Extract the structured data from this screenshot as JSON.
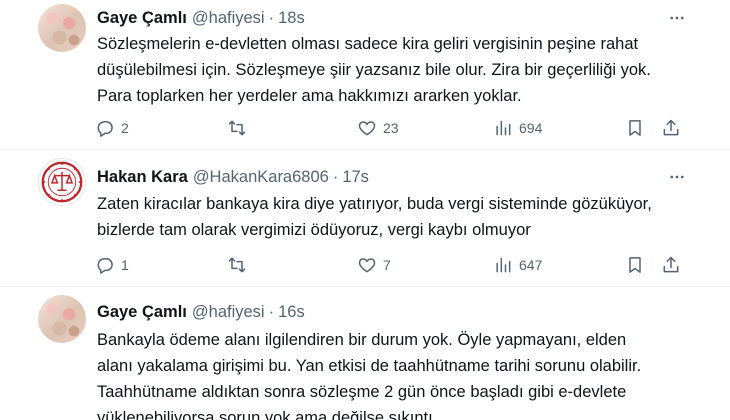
{
  "tweets": [
    {
      "name": "Gaye Çamlı",
      "handle": "@hafiyesi",
      "dot": "·",
      "time": "18s",
      "lines": [
        "Sözleşmelerin e-devletten olması sadece kira geliri vergisinin peşine rahat",
        "düşülebilmesi için. Sözleşmeye şiir yazsanız bile olur. Zira bir geçerliliği yok.",
        "Para toplarken her yerdeler ama hakkımızı ararken yoklar."
      ],
      "replies": "2",
      "retweets": "",
      "likes": "23",
      "views": "694"
    },
    {
      "name": "Hakan Kara",
      "handle": "@HakanKara6806",
      "dot": "·",
      "time": "17s",
      "lines": [
        "Zaten kiracılar bankaya kira diye yatırıyor, buda vergi sisteminde gözüküyor,",
        "bizlerde tam olarak vergimizi ödüyoruz, vergi kaybı olmuyor"
      ],
      "replies": "1",
      "retweets": "",
      "likes": "7",
      "views": "647"
    },
    {
      "name": "Gaye Çamlı",
      "handle": "@hafiyesi",
      "dot": "·",
      "time": "16s",
      "lines": [
        "Bankayla ödeme alanı ilgilendiren bir durum yok. Öyle yapmayanı, elden",
        "alanı yakalama girişimi bu. Yan etkisi de taahhütname tarihi sorunu olabilir.",
        "Taahhütname aldıktan sonra sözleşme 2 gün önce başladı gibi e-devlete",
        "yüklenebiliyorsa sorun yok ama değilse sıkıntı."
      ]
    }
  ],
  "icons": {
    "more": "more-horizontal-icon",
    "reply": "reply-icon",
    "retweet": "retweet-icon",
    "like": "heart-icon",
    "views": "views-chart-icon",
    "bookmark": "bookmark-icon",
    "share": "share-icon"
  },
  "colors": {
    "text": "#0f1419",
    "secondary": "#536471",
    "divider": "#eff3f4",
    "seal_red": "#c0272d"
  }
}
